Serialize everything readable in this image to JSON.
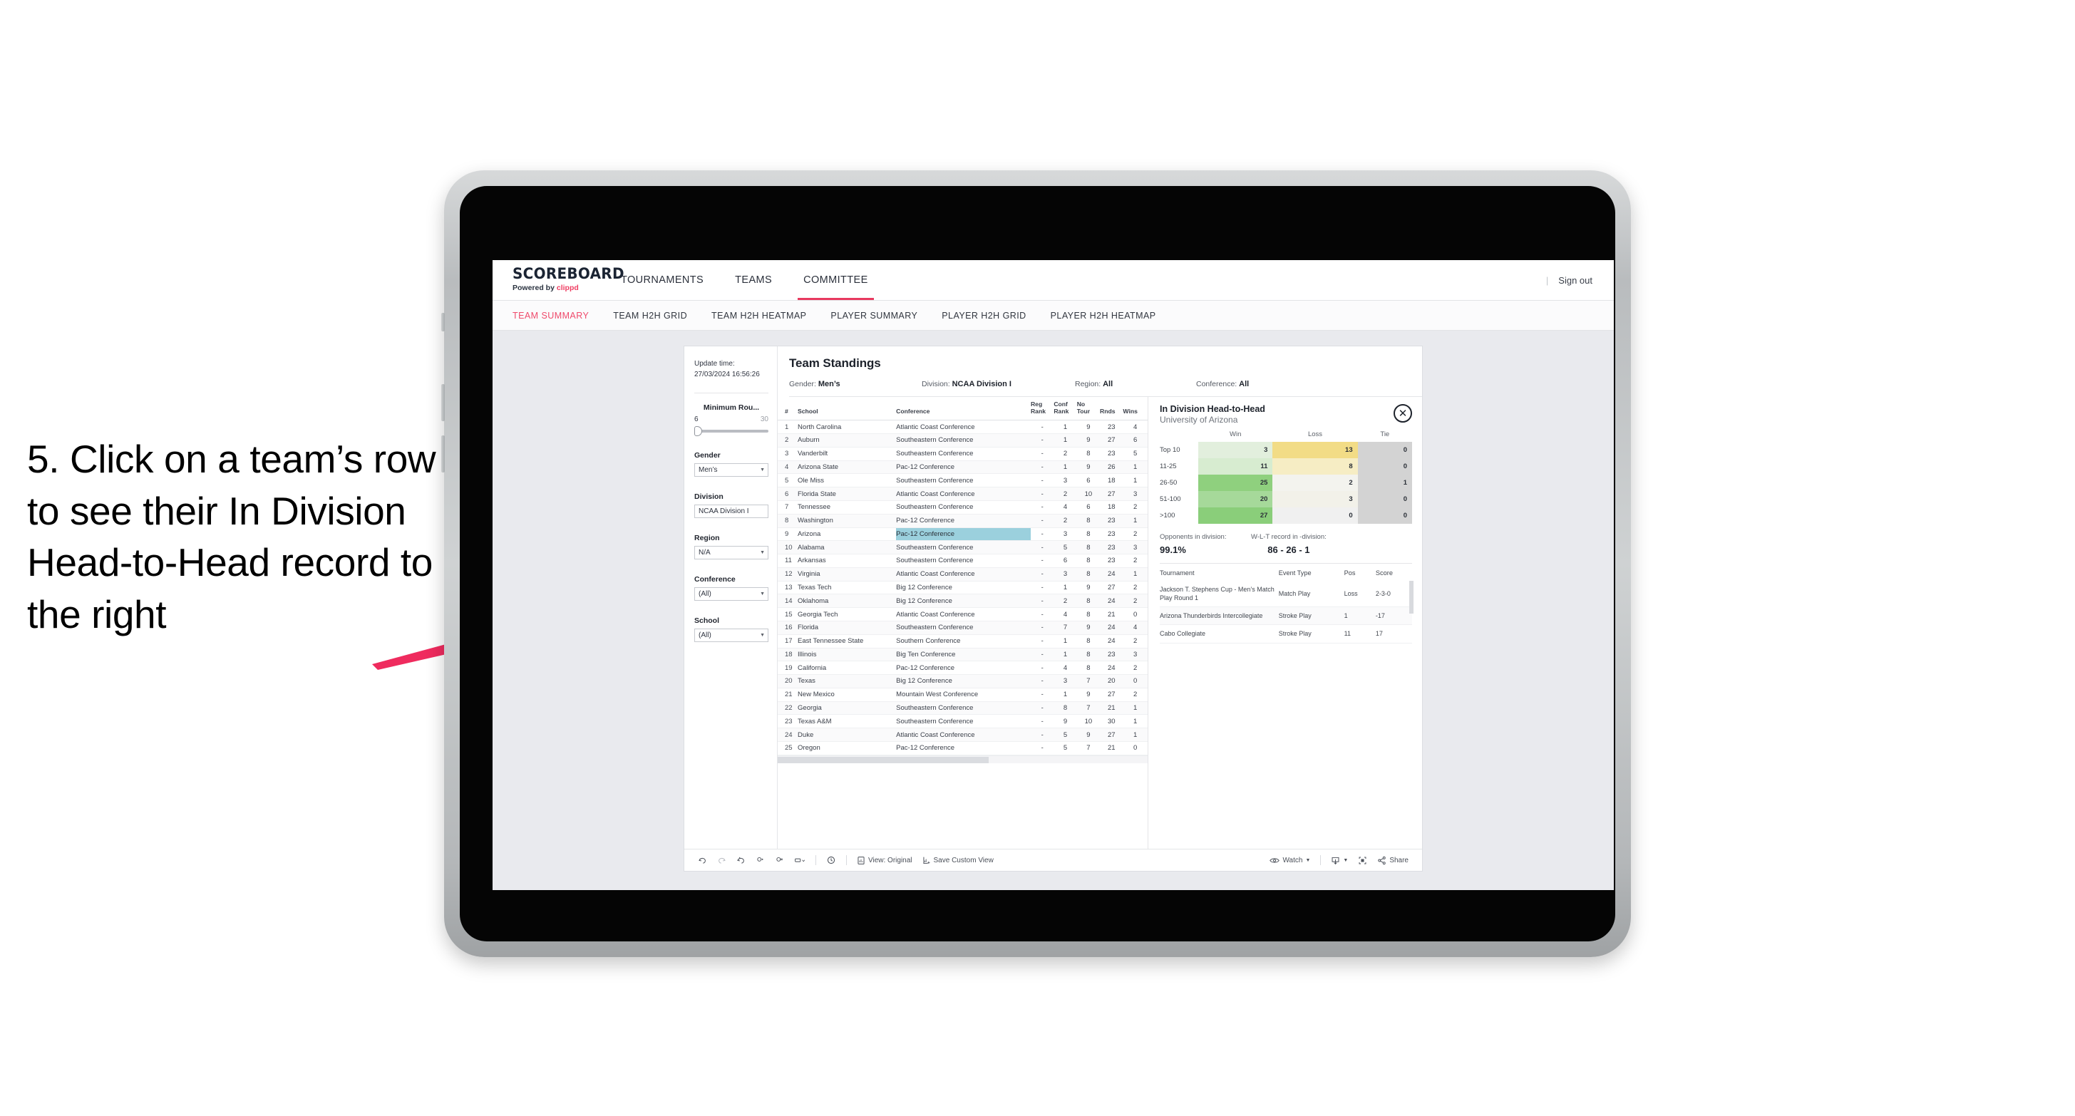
{
  "annotation": {
    "text": "5. Click on a team’s row to see their In Division Head-to-Head record to the right",
    "arrow_color": "#ef2b5e"
  },
  "topnav": {
    "logo_main": "SCOREBOARD",
    "logo_sub_prefix": "Powered by ",
    "logo_sub_brand": "clippd",
    "items": [
      {
        "label": "TOURNAMENTS",
        "active": false
      },
      {
        "label": "TEAMS",
        "active": false
      },
      {
        "label": "COMMITTEE",
        "active": true
      }
    ],
    "divider": "|",
    "signout": "Sign out",
    "accent": "#e8395f"
  },
  "subnav": {
    "items": [
      {
        "label": "TEAM SUMMARY",
        "active": true
      },
      {
        "label": "TEAM H2H GRID",
        "active": false
      },
      {
        "label": "TEAM H2H HEATMAP",
        "active": false
      },
      {
        "label": "PLAYER SUMMARY",
        "active": false
      },
      {
        "label": "PLAYER H2H GRID",
        "active": false
      },
      {
        "label": "PLAYER H2H HEATMAP",
        "active": false
      }
    ]
  },
  "filters": {
    "update_time_label": "Update time:",
    "update_time_value": "27/03/2024 16:56:26",
    "min_rounds": {
      "label": "Minimum Rou...",
      "low": "6",
      "high": "30"
    },
    "groups": [
      {
        "label": "Gender",
        "value": "Men’s"
      },
      {
        "label": "Division",
        "value": "NCAA Division I"
      },
      {
        "label": "Region",
        "value": "N/A"
      },
      {
        "label": "Conference",
        "value": "(All)"
      },
      {
        "label": "School",
        "value": "(All)"
      }
    ]
  },
  "viz": {
    "title": "Team Standings",
    "filter_line": [
      {
        "label": "Gender: ",
        "value": "Men’s"
      },
      {
        "label": "Division: ",
        "value": "NCAA Division I"
      },
      {
        "label": "Region: ",
        "value": "All"
      },
      {
        "label": "Conference: ",
        "value": "All"
      }
    ]
  },
  "standings": {
    "columns": [
      "#",
      "School",
      "Conference",
      "Reg Rank",
      "Conf Rank",
      "No Tour",
      "Rnds",
      "Wins"
    ],
    "highlight_color": "#9bd0dd",
    "highlighted_row": 9,
    "rows": [
      {
        "rank": "1",
        "school": "North Carolina",
        "conference": "Atlantic Coast Conference",
        "reg": "-",
        "conf": "1",
        "notour": "9",
        "rnds": "23",
        "wins": "4"
      },
      {
        "rank": "2",
        "school": "Auburn",
        "conference": "Southeastern Conference",
        "reg": "-",
        "conf": "1",
        "notour": "9",
        "rnds": "27",
        "wins": "6"
      },
      {
        "rank": "3",
        "school": "Vanderbilt",
        "conference": "Southeastern Conference",
        "reg": "-",
        "conf": "2",
        "notour": "8",
        "rnds": "23",
        "wins": "5"
      },
      {
        "rank": "4",
        "school": "Arizona State",
        "conference": "Pac-12 Conference",
        "reg": "-",
        "conf": "1",
        "notour": "9",
        "rnds": "26",
        "wins": "1"
      },
      {
        "rank": "5",
        "school": "Ole Miss",
        "conference": "Southeastern Conference",
        "reg": "-",
        "conf": "3",
        "notour": "6",
        "rnds": "18",
        "wins": "1"
      },
      {
        "rank": "6",
        "school": "Florida State",
        "conference": "Atlantic Coast Conference",
        "reg": "-",
        "conf": "2",
        "notour": "10",
        "rnds": "27",
        "wins": "3"
      },
      {
        "rank": "7",
        "school": "Tennessee",
        "conference": "Southeastern Conference",
        "reg": "-",
        "conf": "4",
        "notour": "6",
        "rnds": "18",
        "wins": "2"
      },
      {
        "rank": "8",
        "school": "Washington",
        "conference": "Pac-12 Conference",
        "reg": "-",
        "conf": "2",
        "notour": "8",
        "rnds": "23",
        "wins": "1"
      },
      {
        "rank": "9",
        "school": "Arizona",
        "conference": "Pac-12 Conference",
        "reg": "-",
        "conf": "3",
        "notour": "8",
        "rnds": "23",
        "wins": "2"
      },
      {
        "rank": "10",
        "school": "Alabama",
        "conference": "Southeastern Conference",
        "reg": "-",
        "conf": "5",
        "notour": "8",
        "rnds": "23",
        "wins": "3"
      },
      {
        "rank": "11",
        "school": "Arkansas",
        "conference": "Southeastern Conference",
        "reg": "-",
        "conf": "6",
        "notour": "8",
        "rnds": "23",
        "wins": "2"
      },
      {
        "rank": "12",
        "school": "Virginia",
        "conference": "Atlantic Coast Conference",
        "reg": "-",
        "conf": "3",
        "notour": "8",
        "rnds": "24",
        "wins": "1"
      },
      {
        "rank": "13",
        "school": "Texas Tech",
        "conference": "Big 12 Conference",
        "reg": "-",
        "conf": "1",
        "notour": "9",
        "rnds": "27",
        "wins": "2"
      },
      {
        "rank": "14",
        "school": "Oklahoma",
        "conference": "Big 12 Conference",
        "reg": "-",
        "conf": "2",
        "notour": "8",
        "rnds": "24",
        "wins": "2"
      },
      {
        "rank": "15",
        "school": "Georgia Tech",
        "conference": "Atlantic Coast Conference",
        "reg": "-",
        "conf": "4",
        "notour": "8",
        "rnds": "21",
        "wins": "0"
      },
      {
        "rank": "16",
        "school": "Florida",
        "conference": "Southeastern Conference",
        "reg": "-",
        "conf": "7",
        "notour": "9",
        "rnds": "24",
        "wins": "4"
      },
      {
        "rank": "17",
        "school": "East Tennessee State",
        "conference": "Southern Conference",
        "reg": "-",
        "conf": "1",
        "notour": "8",
        "rnds": "24",
        "wins": "2"
      },
      {
        "rank": "18",
        "school": "Illinois",
        "conference": "Big Ten Conference",
        "reg": "-",
        "conf": "1",
        "notour": "8",
        "rnds": "23",
        "wins": "3"
      },
      {
        "rank": "19",
        "school": "California",
        "conference": "Pac-12 Conference",
        "reg": "-",
        "conf": "4",
        "notour": "8",
        "rnds": "24",
        "wins": "2"
      },
      {
        "rank": "20",
        "school": "Texas",
        "conference": "Big 12 Conference",
        "reg": "-",
        "conf": "3",
        "notour": "7",
        "rnds": "20",
        "wins": "0"
      },
      {
        "rank": "21",
        "school": "New Mexico",
        "conference": "Mountain West Conference",
        "reg": "-",
        "conf": "1",
        "notour": "9",
        "rnds": "27",
        "wins": "2"
      },
      {
        "rank": "22",
        "school": "Georgia",
        "conference": "Southeastern Conference",
        "reg": "-",
        "conf": "8",
        "notour": "7",
        "rnds": "21",
        "wins": "1"
      },
      {
        "rank": "23",
        "school": "Texas A&M",
        "conference": "Southeastern Conference",
        "reg": "-",
        "conf": "9",
        "notour": "10",
        "rnds": "30",
        "wins": "1"
      },
      {
        "rank": "24",
        "school": "Duke",
        "conference": "Atlantic Coast Conference",
        "reg": "-",
        "conf": "5",
        "notour": "9",
        "rnds": "27",
        "wins": "1"
      },
      {
        "rank": "25",
        "school": "Oregon",
        "conference": "Pac-12 Conference",
        "reg": "-",
        "conf": "5",
        "notour": "7",
        "rnds": "21",
        "wins": "0"
      }
    ]
  },
  "detail": {
    "title": "In Division Head-to-Head",
    "subtitle": "University of Arizona",
    "close_icon": "close-icon",
    "heatmap": {
      "columns": [
        "Win",
        "Loss",
        "Tie"
      ],
      "rows": [
        {
          "label": "Top 10",
          "win": "3",
          "loss": "13",
          "tie": "0",
          "win_color": "#e2efdd",
          "loss_color": "#f2dc86",
          "tie_color": "#d3d3d3"
        },
        {
          "label": "11-25",
          "win": "11",
          "loss": "8",
          "tie": "0",
          "win_color": "#d7ecd0",
          "loss_color": "#f6edc4",
          "tie_color": "#d3d3d3"
        },
        {
          "label": "26-50",
          "win": "25",
          "loss": "2",
          "tie": "1",
          "win_color": "#8fd07e",
          "loss_color": "#f3f3ee",
          "tie_color": "#d3d3d3"
        },
        {
          "label": "51-100",
          "win": "20",
          "loss": "3",
          "tie": "0",
          "win_color": "#a6d99a",
          "loss_color": "#f2f1e9",
          "tie_color": "#d3d3d3"
        },
        {
          "label": ">100",
          "win": "27",
          "loss": "0",
          "tie": "0",
          "win_color": "#8ace7a",
          "loss_color": "#f0f0f0",
          "tie_color": "#d3d3d3"
        }
      ]
    },
    "stats": [
      {
        "label": "Opponents in division:",
        "value": "99.1%"
      },
      {
        "label": "W-L-T record in -division:",
        "value": "86 - 26 - 1"
      }
    ],
    "tournaments": {
      "columns": [
        "Tournament",
        "Event Type",
        "Pos",
        "Score"
      ],
      "rows": [
        {
          "name": "Jackson T. Stephens Cup - Men’s Match Play Round 1",
          "type": "Match Play",
          "pos": "Loss",
          "score": "2-3-0"
        },
        {
          "name": "Arizona Thunderbirds Intercollegiate",
          "type": "Stroke Play",
          "pos": "1",
          "score": "-17"
        },
        {
          "name": "Cabo Collegiate",
          "type": "Stroke Play",
          "pos": "11",
          "score": "17"
        }
      ]
    }
  },
  "toolbar": {
    "view_label": "View: Original",
    "save_label": "Save Custom View",
    "watch_label": "Watch",
    "share_label": "Share"
  }
}
